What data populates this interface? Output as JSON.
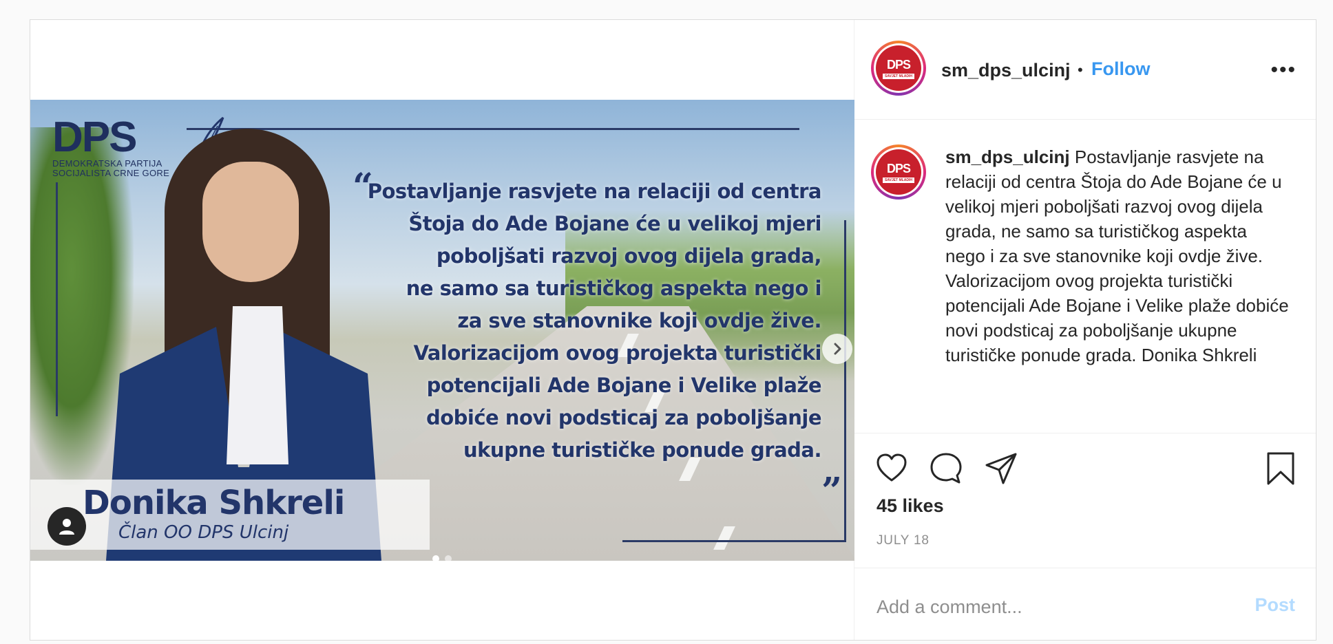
{
  "post": {
    "username": "sm_dps_ulcinj",
    "follow_label": "Follow",
    "separator": "•",
    "more_label": "•••",
    "avatar_letters": "DPS",
    "avatar_subtext": "SAVJET MLADIH",
    "caption_user": "sm_dps_ulcinj",
    "caption_text": "Postavljanje rasvjete na relaciji od centra Štoja do Ade Bojane će u velikoj mjeri poboljšati razvoj ovog dijela grada, ne samo sa turističkog aspekta nego i za sve stanovnike koji ovdje žive. Valorizacijom ovog projekta turistički potencijali Ade Bojane i Velike plaže dobiće novi podsticaj za poboljšanje ukupne turističke ponude grada. Donika Shkreli",
    "likes": "45 likes",
    "date": "JULY 18",
    "comment_placeholder": "Add a comment...",
    "post_label": "Post"
  },
  "image": {
    "logo_letters": "DPS",
    "logo_sub1": "DEMOKRATSKA PARTIJA",
    "logo_sub2": "SOCIJALISTA CRNE GORE",
    "quote_open": "“",
    "quote_close": "„",
    "quote_lines": [
      "Postavljanje rasvjete na relaciji od centra",
      "Štoja do Ade Bojane će u velikoj mjeri",
      "poboljšati razvoj ovog dijela grada,",
      "ne samo sa turističkog aspekta nego i",
      "za sve stanovnike koji ovdje žive.",
      "Valorizacijom ovog projekta turistički",
      "potencijali Ade Bojane i Velike plaže",
      "dobiće novi podsticaj za poboljšanje",
      "ukupne turističke ponude grada."
    ],
    "person_name": "Donika Shkreli",
    "person_role": "Član OO DPS Ulcinj",
    "carousel_count": 2,
    "carousel_active": 1
  },
  "colors": {
    "link": "#3897f0",
    "post_disabled": "#b3dbff",
    "text": "#262626",
    "muted": "#8e8e8e",
    "brand_navy": "#22356a",
    "brand_red": "#c8202c"
  },
  "icons": [
    "tag-user-icon",
    "chevron-right-icon",
    "heart-icon",
    "comment-icon",
    "share-icon",
    "bookmark-icon",
    "more-icon",
    "quill-icon"
  ]
}
